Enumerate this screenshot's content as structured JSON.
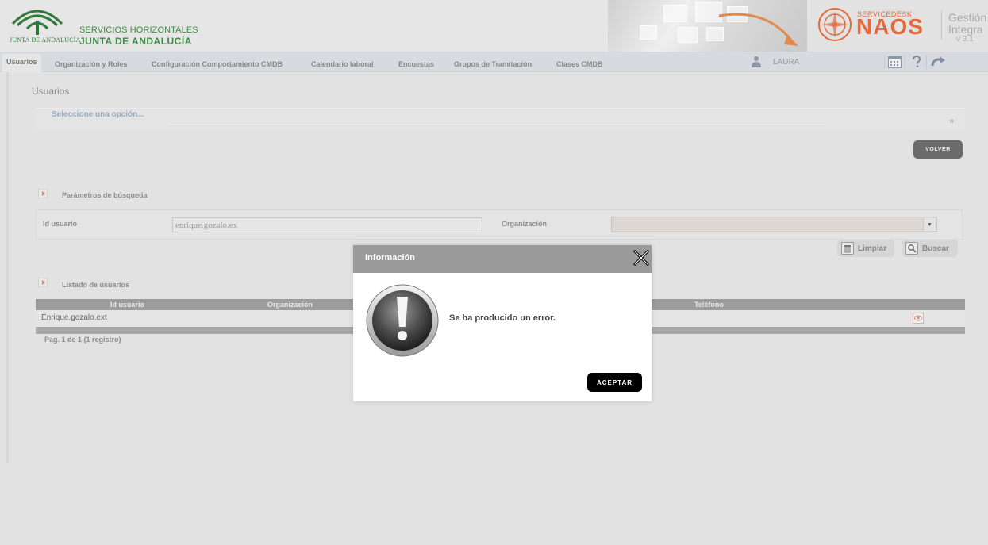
{
  "header": {
    "logo_text": "JUNTA DE ANDALUCÍA",
    "brand_line1": "SERVICIOS HORIZONTALES",
    "brand_line2": "JUNTA DE ANDALUCÍA",
    "product_prefix": "SERVICEDESK",
    "product_name": "NAOS",
    "gestion_line1": "Gestión",
    "gestion_line2": "Integra",
    "version": "v 3.1"
  },
  "nav": {
    "tabs": [
      {
        "label": "Usuarios",
        "active": true
      },
      {
        "label": "Organización y Roles"
      },
      {
        "label": "Configuración Comportamiento CMDB"
      },
      {
        "label": "Calendario laboral"
      },
      {
        "label": "Encuestas"
      },
      {
        "label": "Grupos de Tramitación"
      },
      {
        "label": "Clases CMDB"
      }
    ],
    "user": "LAURA",
    "tools": [
      "calendar-icon",
      "help-icon",
      "logout-icon"
    ]
  },
  "page": {
    "title": "Usuarios",
    "option_label": "Seleccione una opción...",
    "option_more": "»",
    "back_button": "VOLVER"
  },
  "search": {
    "title": "Parámetros de búsqueda",
    "id_label": "Id usuario",
    "id_value": "enrique.gozalo.ex",
    "org_label": "Organización",
    "org_value": "",
    "clear_button": "Limpiar",
    "search_button": "Buscar"
  },
  "list": {
    "title": "Listado de usuarios",
    "columns": [
      "Id usuario",
      "Organización",
      "Teléfono"
    ],
    "rows": [
      {
        "id": "Enrique.gozalo.ext",
        "organizacion": "",
        "telefono": ""
      }
    ],
    "pager": "Pag. 1 de 1 (1 registro)"
  },
  "modal": {
    "title": "Información",
    "message": "Se ha producido un error.",
    "ok_button": "ACEPTAR"
  },
  "colors": {
    "brand_green": "#3d8a44",
    "naos_orange": "#e36a3c",
    "modal_header": "#9a9a9a",
    "button_dark": "#6b6b6b"
  }
}
